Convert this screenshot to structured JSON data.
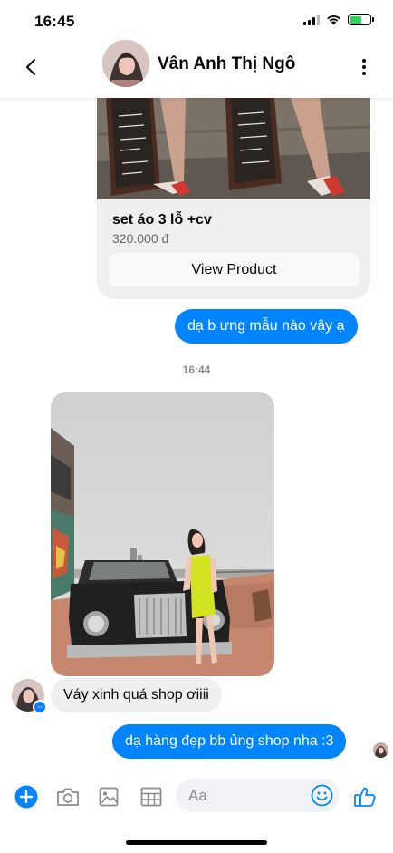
{
  "status_bar": {
    "time": "16:45",
    "icons": [
      "signal-icon",
      "wifi-icon",
      "battery-charging-icon"
    ]
  },
  "header": {
    "contact_name": "Vân Anh Thị Ngô",
    "back_icon": "chevron-left-icon",
    "more_icon": "more-vertical-icon"
  },
  "product": {
    "title": "set áo 3 lỗ +cv",
    "price": "320.000 đ",
    "button_label": "View Product"
  },
  "messages": [
    {
      "direction": "outgoing",
      "text": "dạ b ưng mẫu nào vậy ạ"
    },
    {
      "type": "timestamp",
      "text": "16:44"
    },
    {
      "direction": "incoming",
      "type": "photo"
    },
    {
      "direction": "incoming",
      "text": "Váy xinh quá shop ơiiii"
    },
    {
      "direction": "outgoing",
      "text": "dạ hàng đẹp bb ủng shop nha :3"
    }
  ],
  "composer": {
    "placeholder": "Aa",
    "icons": [
      "plus-circle-icon",
      "camera-icon",
      "image-icon",
      "sticker-icon",
      "emoji-icon",
      "thumbs-up-icon"
    ]
  },
  "colors": {
    "accent": "#0084ff",
    "incoming_bubble": "#efefef",
    "timestamp": "#8a8d91",
    "battery_fill": "#30d158"
  }
}
